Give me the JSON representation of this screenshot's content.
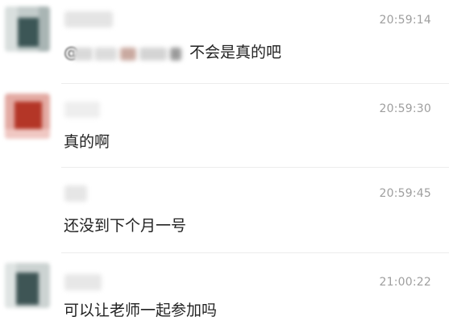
{
  "messages": [
    {
      "time": "20:59:14",
      "text": "不会是真的吧",
      "mention": "@",
      "avatar_colors": [
        "#b9c4c3",
        "#3c5656",
        "#d7dddc"
      ],
      "name_color": "#e4e4e4"
    },
    {
      "time": "20:59:30",
      "text": "真的啊",
      "avatar_colors": [
        "#e6b7b2",
        "#b43627",
        "#d56a5f"
      ],
      "name_color": "#eeeeee"
    },
    {
      "time": "20:59:45",
      "text": "还没到下个月一号",
      "avatar_colors": [
        "#f3f3f3",
        "#e4e4e4",
        "#ffffff"
      ],
      "name_color": "#eeeeee"
    },
    {
      "time": "21:00:22",
      "text": "可以让老师一起参加吗",
      "avatar_colors": [
        "#cfd6d5",
        "#3e5555",
        "#aeb8b7"
      ],
      "name_color": "#e7e7e7"
    }
  ],
  "colors": {
    "background": "#ffffff",
    "text": "#222222",
    "time": "#9e9e9e",
    "divider": "#ececec"
  }
}
